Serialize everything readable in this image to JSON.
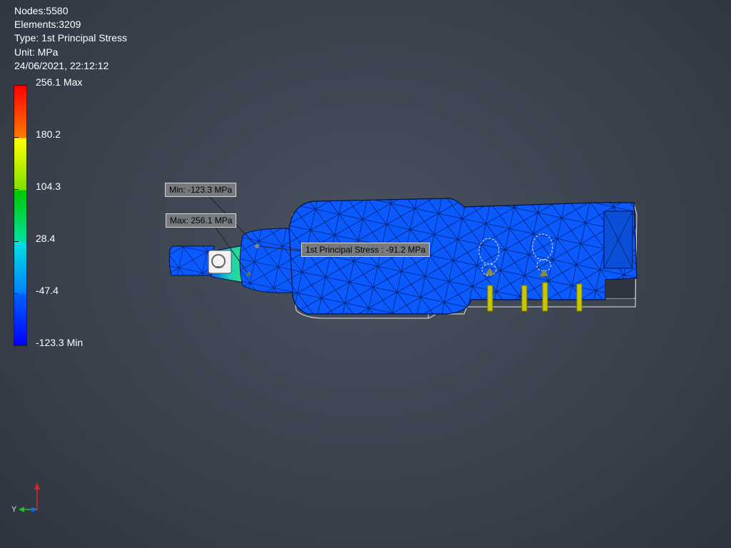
{
  "info": {
    "nodes": "Nodes:5580",
    "elements": "Elements:3209",
    "type": "Type: 1st Principal Stress",
    "unit": "Unit: MPa",
    "timestamp": "24/06/2021, 22:12:12"
  },
  "legend": {
    "labels": [
      "256.1 Max",
      "180.2",
      "104.3",
      "28.4",
      "-47.4",
      "-123.3 Min"
    ]
  },
  "probes": {
    "min": "Min: -123.3 MPa",
    "max": "Max: 256.1 MPa",
    "point": "1st Principal Stress : -91.2 MPa"
  },
  "triad": {
    "y_label": "Y"
  },
  "colors": {
    "mesh_fill": "#0a5aff",
    "mesh_line": "#00103a",
    "wireframe": "#e8e8e8",
    "constraint": "#c8c800"
  }
}
